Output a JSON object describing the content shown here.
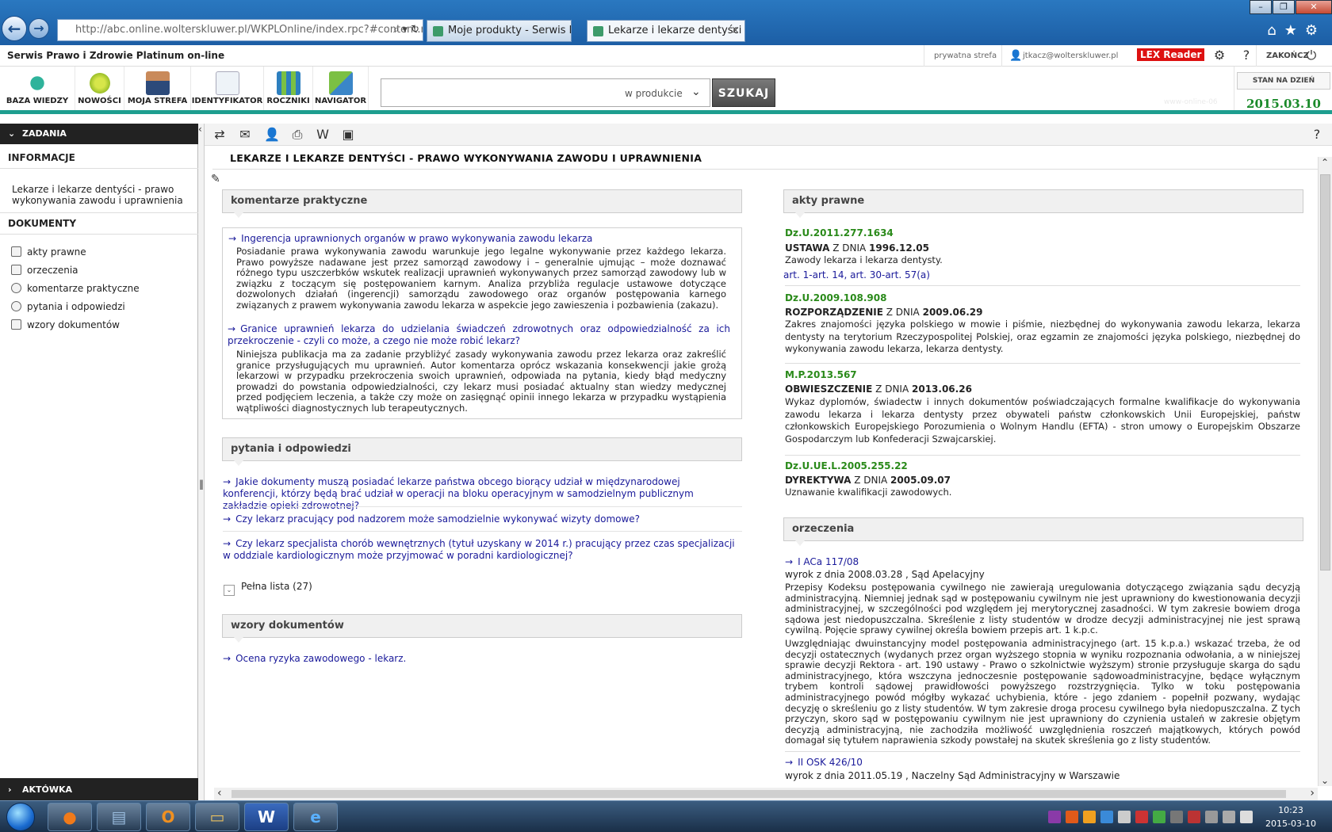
{
  "browser": {
    "address": "http://abc.online.wolterskluwer.pl/WKPLOnline/index.rpc?#content.rpc--",
    "tabs": [
      {
        "label": "Moje produkty - Serwis logow..."
      },
      {
        "label": "Lekarze i lekarze dentyści - ..."
      }
    ],
    "close_glyph": "×"
  },
  "app": {
    "title": "Serwis Prawo i Zdrowie Platinum on-line",
    "private_zone": "prywatna strefa",
    "user_email": "jtkacz@wolterskluwer.pl",
    "lex_reader": "LEX Reader",
    "logout": "ZAKOŃCZ"
  },
  "toolbar": {
    "items": [
      "BAZA WIEDZY",
      "NOWOŚCI",
      "MOJA STREFA",
      "IDENTYFIKATOR",
      "ROCZNIKI",
      "NAVIGATOR"
    ],
    "search_scope": "w produkcie",
    "search_button": "SZUKAJ",
    "date_label": "STAN NA DZIEŃ",
    "date_value": "2015.03.10",
    "watermark": "www-online-06"
  },
  "sidebar": {
    "tasks": "ZADANIA",
    "info_heading": "INFORMACJE",
    "info_item": "Lekarze i lekarze dentyści - prawo wykonywania zawodu i uprawnienia",
    "docs_heading": "DOKUMENTY",
    "docs": [
      "akty prawne",
      "orzeczenia",
      "komentarze praktyczne",
      "pytania i odpowiedzi",
      "wzory dokumentów"
    ],
    "briefcase": "AKTÓWKA"
  },
  "content": {
    "title": "LEKARZE I LEKARZE DENTYŚCI - PRAWO WYKONYWANIA ZAWODU I UPRAWNIENIA",
    "comments_head": "komentarze praktyczne",
    "comments": [
      {
        "title": "Ingerencja uprawnionych organów w prawo wykonywania zawodu lekarza",
        "body": "Posiadanie prawa wykonywania zawodu warunkuje jego legalne wykonywanie przez każdego lekarza. Prawo powyższe nadawane jest przez samorząd zawodowy i – generalnie ujmując – może doznawać różnego typu uszczerbków wskutek realizacji uprawnień wykonywanych przez samorząd zawodowy lub w związku z toczącym się postępowaniem karnym. Analiza przybliża regulacje ustawowe dotyczące dozwolonych działań (ingerencji) samorządu zawodowego oraz organów postępowania karnego związanych z prawem wykonywania zawodu lekarza w aspekcie jego zawieszenia i pozbawienia (zakazu)."
      },
      {
        "title": "Granice uprawnień lekarza do udzielania świadczeń zdrowotnych oraz odpowiedzialność za ich przekroczenie - czyli co może, a czego nie może robić lekarz?",
        "body": "Niniejsza publikacja ma za zadanie przybliżyć zasady wykonywania zawodu przez lekarza oraz zakreślić granice przysługujących mu uprawnień. Autor komentarza oprócz wskazania konsekwencji jakie grożą lekarzowi w przypadku przekroczenia swoich uprawnień, odpowiada na pytania, kiedy błąd medyczny prowadzi do powstania odpowiedzialności, czy lekarz musi posiadać aktualny stan wiedzy medycznej przed podjęciem leczenia, a także czy może on zasięgnąć opinii innego lekarza w przypadku wystąpienia wątpliwości diagnostycznych lub terapeutycznych."
      }
    ],
    "qa_head": "pytania i odpowiedzi",
    "qa": [
      "Jakie dokumenty muszą posiadać lekarze państwa obcego biorący udział w międzynarodowej konferencji, którzy będą brać udział w operacji na bloku operacyjnym w samodzielnym publicznym zakładzie opieki zdrowotnej?",
      "Czy lekarz pracujący pod nadzorem może samodzielnie wykonywać wizyty domowe?",
      "Czy lekarz specjalista chorób wewnętrznych (tytuł uzyskany w 2014 r.) pracujący przez czas specjalizacji w oddziale kardiologicznym może przyjmować w poradni kardiologicznej?"
    ],
    "full_list": "Pełna lista (27)",
    "templates_head": "wzory dokumentów",
    "templates": [
      "Ocena ryzyka zawodowego - lekarz."
    ],
    "acts_head": "akty prawne",
    "acts": [
      {
        "id": "Dz.U.2011.277.1634",
        "kind": "USTAWA",
        "mid": "Z DNIA",
        "date": "1996.12.05",
        "desc": "Zawody lekarza i lekarza dentysty."
      },
      {
        "id": "Dz.U.2009.108.908",
        "kind": "ROZPORZĄDZENIE",
        "mid": "Z DNIA",
        "date": "2009.06.29",
        "desc": "Zakres znajomości języka polskiego w mowie i piśmie, niezbędnej do wykonywania zawodu lekarza, lekarza dentysty na terytorium Rzeczypospolitej Polskiej, oraz egzamin ze znajomości języka polskiego, niezbędnej do wykonywania zawodu lekarza, lekarza dentysty."
      },
      {
        "id": "M.P.2013.567",
        "kind": "OBWIESZCZENIE",
        "mid": "Z DNIA",
        "date": "2013.06.26",
        "desc": "Wykaz dyplomów, świadectw i innych dokumentów poświadczających formalne kwalifikacje do wykonywania zawodu lekarza i lekarza dentysty przez obywateli państw członkowskich Unii Europejskiej, państw członkowskich Europejskiego Porozumienia o Wolnym Handlu (EFTA) - stron umowy o Europejskim Obszarze Gospodarczym lub Konfederacji Szwajcarskiej."
      },
      {
        "id": "Dz.U.UE.L.2005.255.22",
        "kind": "DYREKTYWA",
        "mid": "Z DNIA",
        "date": "2005.09.07",
        "desc": "Uznawanie kwalifikacji zawodowych."
      }
    ],
    "act_range": "art. 1-art. 14, art. 30-art. 57(a)",
    "rulings_head": "orzeczenia",
    "rulings": [
      {
        "sig": "I ACa 117/08",
        "meta": "wyrok z dnia 2008.03.28 , Sąd Apelacyjny",
        "body1": "Przepisy Kodeksu postępowania cywilnego nie zawierają uregulowania dotyczącego związania sądu decyzją administracyjną. Niemniej jednak sąd w postępowaniu cywilnym nie jest uprawniony do kwestionowania decyzji administracyjnej, w szczególności pod względem jej merytorycznej zasadności. W tym zakresie bowiem droga sądowa jest niedopuszczalna. Skreślenie z listy studentów w drodze decyzji administracyjnej nie jest sprawą cywilną. Pojęcie sprawy cywilnej określa bowiem przepis art. 1 k.p.c.",
        "body2": "Uwzględniając dwuinstancyjny model postępowania administracyjnego (art. 15 k.p.a.) wskazać trzeba, że od decyzji ostatecznych (wydanych przez organ wyższego stopnia w wyniku rozpoznania odwołania, a w niniejszej sprawie decyzji Rektora - art. 190 ustawy - Prawo o szkolnictwie wyższym) stronie przysługuje skarga do sądu administracyjnego, która wszczyna jednoczesnie postępowanie sądowoadministracyjne, będące wyłącznym trybem kontroli sądowej prawidłowości powyższego rozstrzygnięcia. Tylko w toku postępowania administracyjnego powód mógłby wykazać uchybienia, które - jego zdaniem - popełnił pozwany, wydając decyzję o skreśleniu go z listy studentów. W tym zakresie droga procesu cywilnego była niedopuszczalna. Z tych przyczyn, skoro sąd w postępowaniu cywilnym nie jest uprawniony do czynienia ustaleń w zakresie objętym decyzją administracyjną, nie zachodziła możliwość uwzględnienia roszczeń majątkowych, których powód domagał się tytułem naprawienia szkody powstałej na skutek skreślenia go z listy studentów."
      },
      {
        "sig": "II OSK 426/10",
        "meta": "wyrok z dnia 2011.05.19 , Naczelny Sąd Administracyjny w Warszawie"
      }
    ],
    "arrow": "→"
  },
  "taskbar": {
    "time": "10:23",
    "date": "2015-03-10"
  },
  "colors": {
    "accent": "#1e9e8f",
    "link": "#1a1a9a",
    "act_id": "#2a8a1a",
    "lex": "#dd1111"
  }
}
